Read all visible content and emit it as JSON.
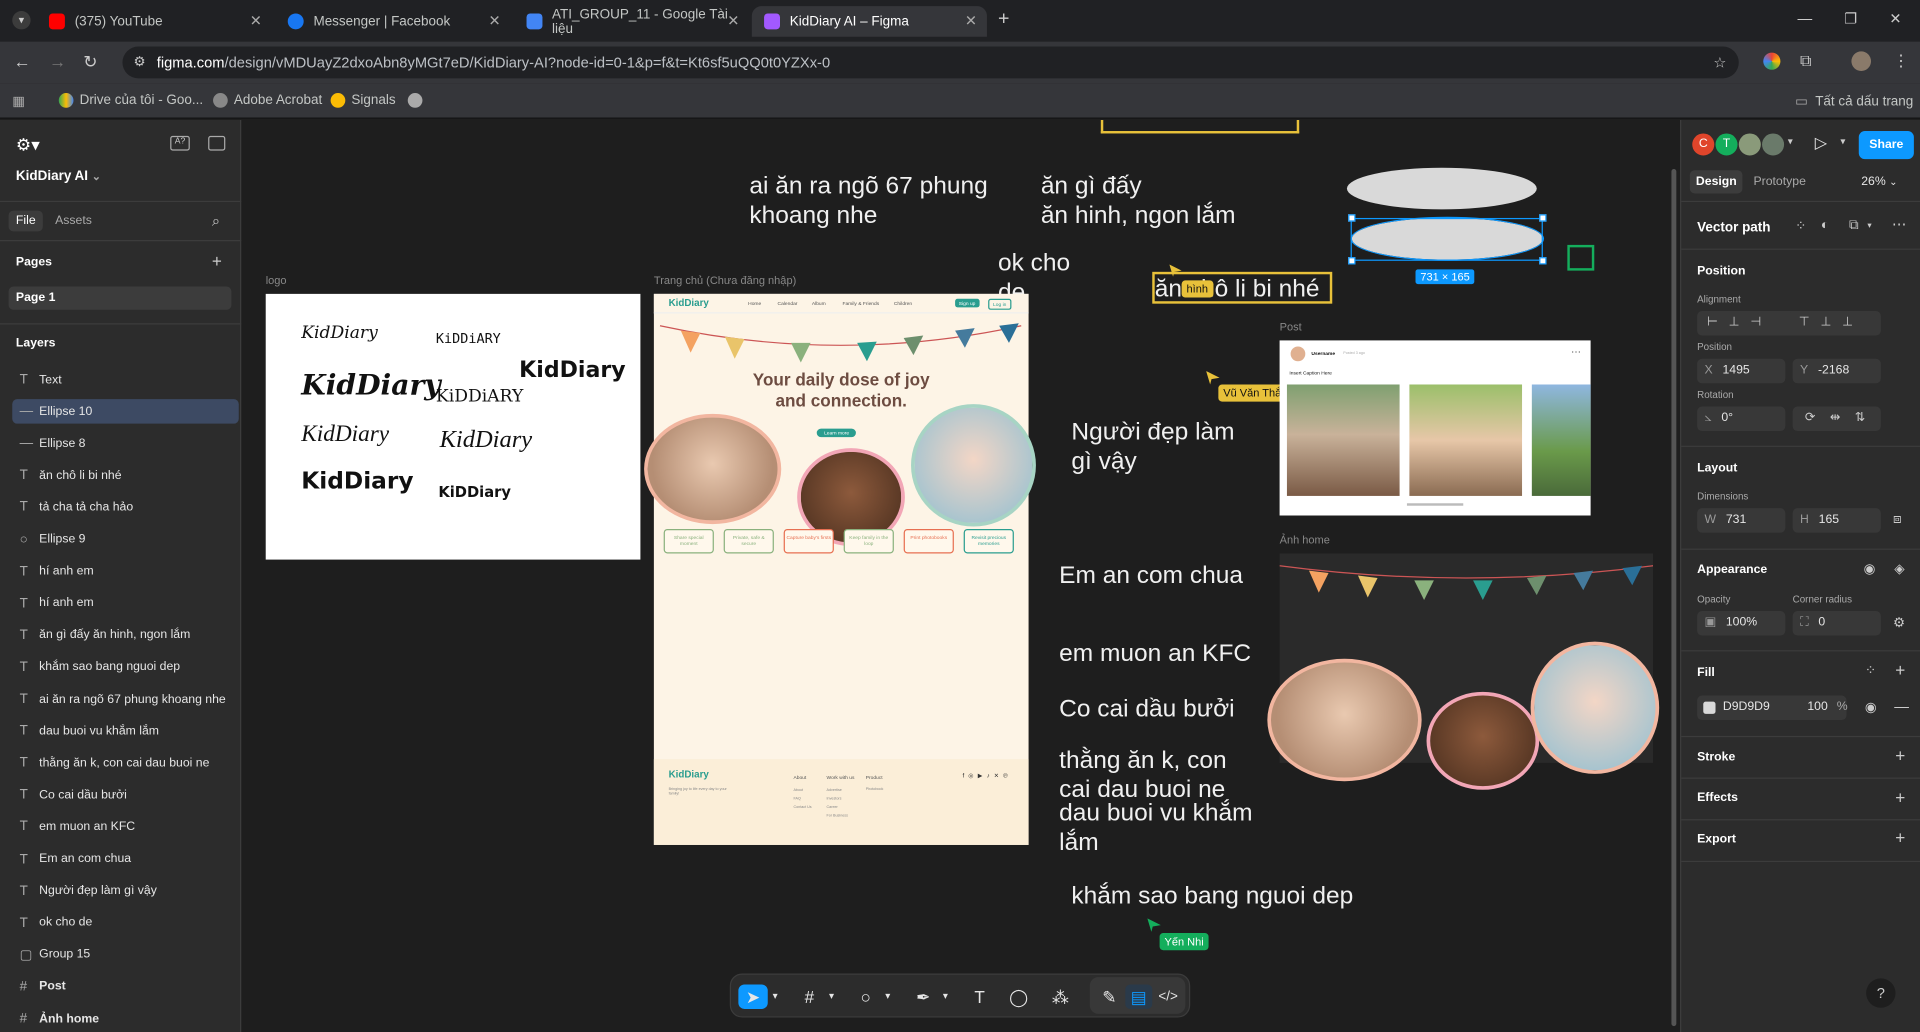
{
  "browser": {
    "tabs": [
      {
        "title": "(375) YouTube",
        "color": "#ff0000"
      },
      {
        "title": "Messenger | Facebook",
        "color": "#1877f2"
      },
      {
        "title": "ATI_GROUP_11 - Google Tài liệu",
        "color": "#4285f4"
      },
      {
        "title": "KidDiary AI – Figma",
        "color": "#a259ff"
      }
    ],
    "url_domain": "figma.com",
    "url_path": "/design/vMDUayZ2dxoAbn8yMGt7eD/KidDiary-AI?node-id=0-1&p=f&t=Kt6sf5uQQ0t0YZXx-0",
    "bookmarks": [
      "Drive của tôi - Goo...",
      "Adobe Acrobat",
      "Signals"
    ],
    "all_bookmarks": "Tất cả dấu trang"
  },
  "left": {
    "project": "KidDiary AI",
    "tab_file": "File",
    "tab_assets": "Assets",
    "pages_label": "Pages",
    "page1": "Page 1",
    "layers_label": "Layers",
    "layers": [
      {
        "icon": "T",
        "name": "Text"
      },
      {
        "icon": "—",
        "name": "Ellipse 10",
        "selected": true
      },
      {
        "icon": "—",
        "name": "Ellipse 8"
      },
      {
        "icon": "T",
        "name": "ăn chô li bi nhé"
      },
      {
        "icon": "T",
        "name": "tả cha tả cha hảo"
      },
      {
        "icon": "○",
        "name": "Ellipse 9"
      },
      {
        "icon": "T",
        "name": "hí anh em"
      },
      {
        "icon": "T",
        "name": "hí anh em"
      },
      {
        "icon": "T",
        "name": "ăn gì đấy ăn hinh, ngon lắm"
      },
      {
        "icon": "T",
        "name": "khắm sao bang nguoi dep"
      },
      {
        "icon": "T",
        "name": "ai ăn ra ngõ 67 phung khoang nhe"
      },
      {
        "icon": "T",
        "name": "dau buoi vu khắm lắm"
      },
      {
        "icon": "T",
        "name": "thằng ăn k, con cai dau buoi ne"
      },
      {
        "icon": "T",
        "name": "Co cai dầu bưởi"
      },
      {
        "icon": "T",
        "name": "em muon an KFC"
      },
      {
        "icon": "T",
        "name": "Em an com chua"
      },
      {
        "icon": "T",
        "name": "Người đẹp làm gì vậy"
      },
      {
        "icon": "T",
        "name": "ok cho de"
      },
      {
        "icon": "▢",
        "name": "Group 15"
      },
      {
        "icon": "#",
        "name": "Post"
      },
      {
        "icon": "#",
        "name": "Ảnh home"
      }
    ]
  },
  "canvas": {
    "texts": {
      "t1": "ai ăn ra ngõ 67 phung\nkhoang nhe",
      "t2": "ăn gì đấy\năn hinh, ngon lắm",
      "t3": "ok cho\nde",
      "t4": "ăn chô li bi nhé",
      "t5": "Người đẹp làm\ngì vậy",
      "t6": "Em an com chua",
      "t7": "em muon an KFC",
      "t8": "Co cai dầu bưởi",
      "t9": "thằng ăn k, con\ncai dau buoi ne",
      "t10": "dau buoi vu khắm\nlắm",
      "t11": "khắm sao bang nguoi dep"
    },
    "frame_logo": "logo",
    "frame_home": "Trang chủ (Chưa đăng nhập)",
    "frame_post": "Post",
    "frame_anh": "Ảnh home",
    "logo_words": [
      "KidDiary",
      "KiDDiARY",
      "KidDiary",
      "KidDiary",
      "KiDDiARY",
      "KidDiary",
      "KidDiary",
      "KidDiary",
      "KiDDiary"
    ],
    "home_heading": "Your daily dose of joy\nand connection.",
    "home_button": "Learn more",
    "home_features": [
      "Share special moment",
      "Private, safe & secure",
      "Capture baby's firsts",
      "Keep family in the loop",
      "Print photobooks",
      "Revisit precious memories"
    ],
    "home_nav": [
      "Home",
      "Calendar",
      "Album",
      "Family & Friends",
      "Children"
    ],
    "home_signup": "Sign up",
    "home_login": "Log in",
    "home_footer_logo": "KidDiary",
    "home_footer_cols": [
      "About",
      "Work with us",
      "Product"
    ],
    "home_footer_links": {
      "about": [
        "About",
        "FAQ",
        "Contact Us"
      ],
      "work": [
        "Advertise",
        "Investors",
        "Career",
        "For Business"
      ],
      "product": [
        "Photobook"
      ]
    },
    "home_footer_tagline": "Bringing joy to life every day to your family!",
    "post_username": "Username",
    "post_caption": "Insert Caption Here",
    "post_time": "Posted 3 ago",
    "dim_badge": "731 × 165",
    "cursor_hinh": "hình",
    "cursor_vu": "Vũ Văn Thắng",
    "cursor_yen": "Yến Nhi"
  },
  "right": {
    "avatars": [
      "C",
      "T"
    ],
    "share": "Share",
    "tab_design": "Design",
    "tab_prototype": "Prototype",
    "zoom": "26%",
    "node_type": "Vector path",
    "position": "Position",
    "alignment": "Alignment",
    "position_sub": "Position",
    "x": "1495",
    "y": "-2168",
    "rotation_label": "Rotation",
    "rotation": "0°",
    "layout": "Layout",
    "dimensions": "Dimensions",
    "w": "731",
    "h": "165",
    "appearance": "Appearance",
    "opacity_label": "Opacity",
    "corner_label": "Corner radius",
    "opacity": "100%",
    "corner": "0",
    "fill": "Fill",
    "fill_hex": "D9D9D9",
    "fill_opacity": "100",
    "fill_pct": "%",
    "stroke": "Stroke",
    "effects": "Effects",
    "export": "Export"
  },
  "colors": {
    "accent": "#0d99ff",
    "selection": "#3d4a63",
    "fill": "#d9d9d9"
  }
}
